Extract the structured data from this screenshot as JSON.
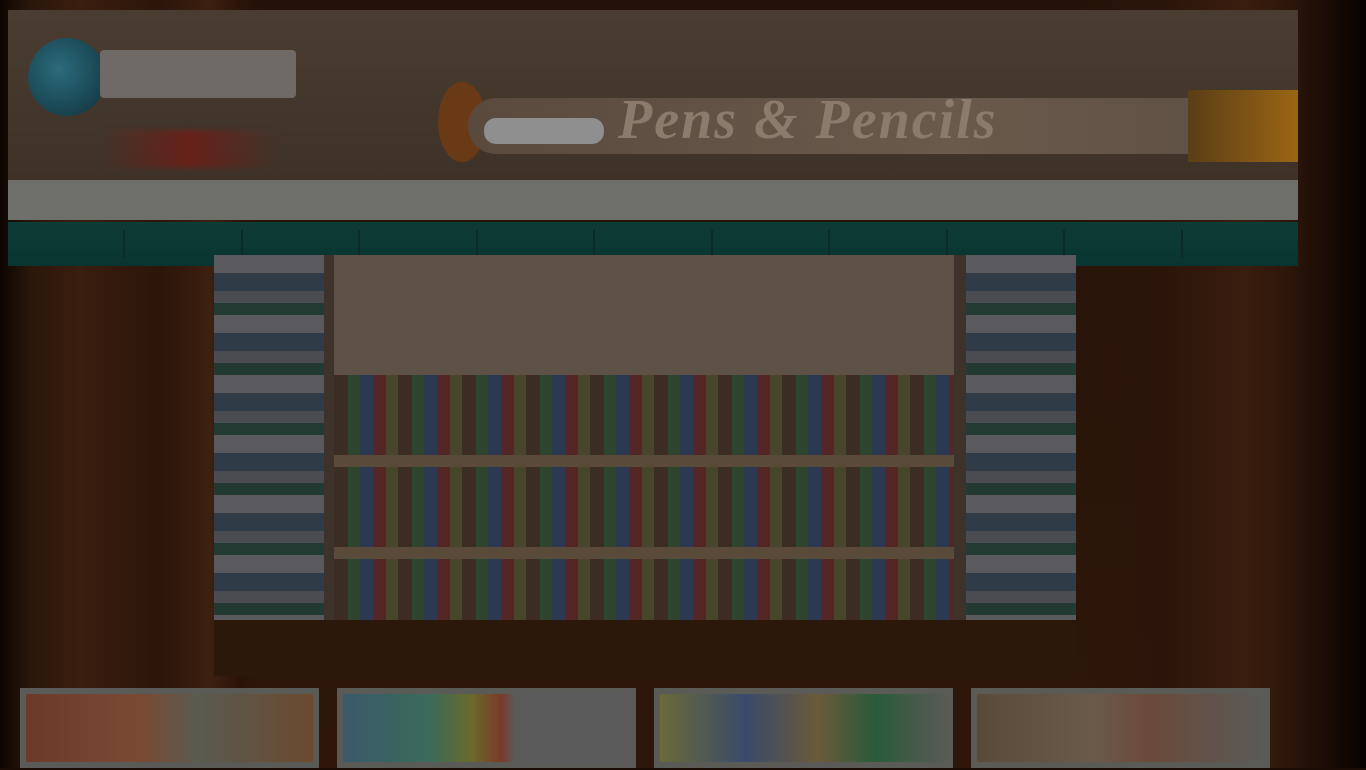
{
  "header": {
    "logo_text": "",
    "tagline": "",
    "banner_title": "Pens & Pencils",
    "strip_text": ""
  },
  "nav": {
    "items": [
      {
        "label": ""
      },
      {
        "label": ""
      },
      {
        "label": ""
      },
      {
        "label": ""
      },
      {
        "label": ""
      },
      {
        "label": ""
      },
      {
        "label": ""
      },
      {
        "label": ""
      },
      {
        "label": ""
      },
      {
        "label": ""
      },
      {
        "label": ""
      }
    ]
  },
  "hero": {
    "caption": ""
  },
  "cards": [
    {
      "label": ""
    },
    {
      "label": ""
    },
    {
      "label": ""
    },
    {
      "label": ""
    }
  ],
  "colors": {
    "nav_bg": "#0e3b36",
    "header_bg": "#4a3c30",
    "page_bg": "#1a0d06"
  }
}
